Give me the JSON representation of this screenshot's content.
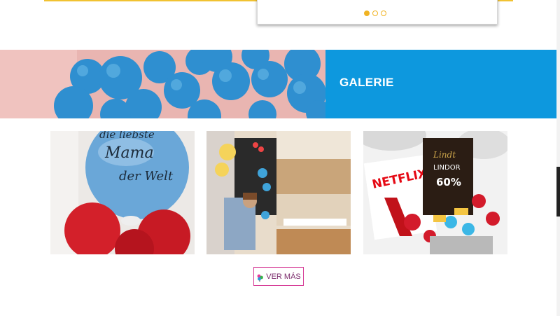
{
  "carousel": {
    "dots": [
      true,
      false,
      false
    ]
  },
  "gallery": {
    "title": "GALERIE",
    "banner_color": "#0d98de",
    "photos": [
      {
        "name": "balloon-mama-photo",
        "caption": "die liebste Mama der Welt"
      },
      {
        "name": "party-room-photo"
      },
      {
        "name": "netflix-gift-photo",
        "brand_text": "NETFLIX",
        "lindt_text": "Lindt",
        "lindor_text": "LINDOR",
        "percent_text": "60%"
      }
    ],
    "more_button": {
      "label": "VER MÁS",
      "icon": "balloon-icon",
      "color": "#d63b96"
    }
  }
}
